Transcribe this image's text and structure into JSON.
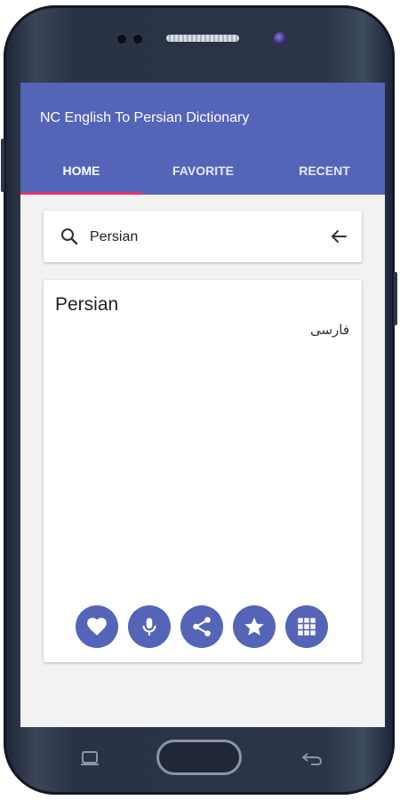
{
  "app": {
    "title": "NC English To Persian Dictionary"
  },
  "tabs": [
    {
      "label": "HOME",
      "active": true
    },
    {
      "label": "FAVORITE",
      "active": false
    },
    {
      "label": "RECENT",
      "active": false
    }
  ],
  "search": {
    "value": "Persian",
    "icon": "search-icon",
    "back_icon": "arrow-left-icon"
  },
  "result": {
    "word": "Persian",
    "translation": "فارسی"
  },
  "actions": [
    {
      "name": "favorite",
      "icon": "heart-icon"
    },
    {
      "name": "speak",
      "icon": "microphone-icon"
    },
    {
      "name": "share",
      "icon": "share-icon"
    },
    {
      "name": "rate",
      "icon": "star-icon"
    },
    {
      "name": "more-apps",
      "icon": "grid-icon"
    }
  ],
  "colors": {
    "primary": "#5465b8",
    "accent": "#e0336e",
    "background": "#f2f2f2"
  }
}
